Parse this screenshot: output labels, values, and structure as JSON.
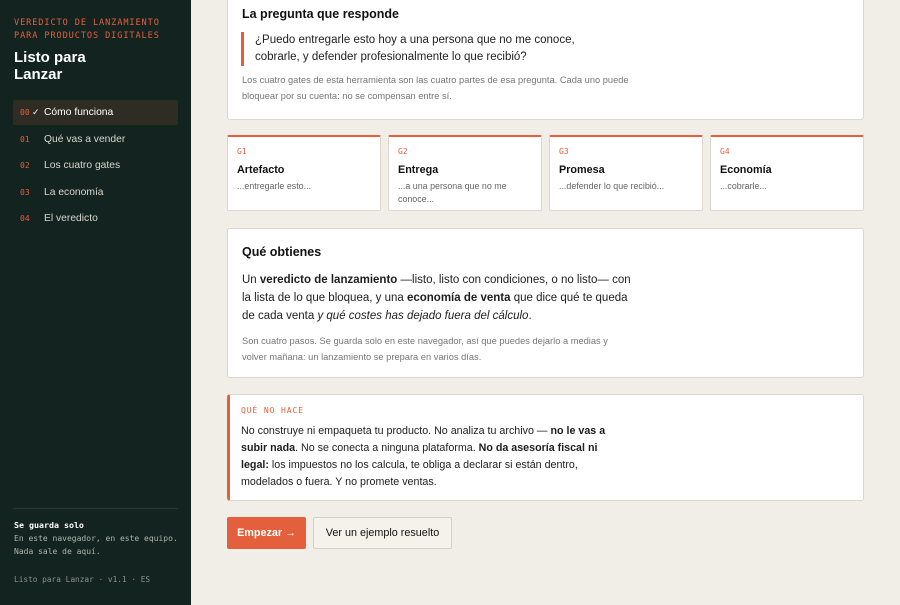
{
  "sidebar": {
    "kicker": "Veredicto de lanzamiento para productos digitales",
    "title": "Listo para Lanzar",
    "items": [
      {
        "num": "00",
        "check": "✓",
        "label": "Cómo funciona"
      },
      {
        "num": "01",
        "label": "Qué vas a vender"
      },
      {
        "num": "02",
        "label": "Los cuatro gates"
      },
      {
        "num": "03",
        "label": "La economía"
      },
      {
        "num": "04",
        "label": "El veredicto"
      }
    ],
    "save_title": "Se guarda solo",
    "save_body": "En este navegador, en este equipo. Nada sale de aquí.",
    "version": "Listo para Lanzar · v1.1 · ES"
  },
  "question": {
    "heading": "La pregunta que responde",
    "quote": "¿Puedo entregarle esto hoy a una persona que no me conoce, cobrarle, y defender profesionalmente lo que recibió?",
    "note": "Los cuatro gates de esta herramienta son las cuatro partes de esa pregunta. Cada uno puede bloquear por su cuenta: no se compensan entre sí."
  },
  "gates": [
    {
      "code": "G1",
      "title": "Artefacto",
      "desc": "...entregarle esto..."
    },
    {
      "code": "G2",
      "title": "Entrega",
      "desc": "...a una persona que no me conoce..."
    },
    {
      "code": "G3",
      "title": "Promesa",
      "desc": "...defender lo que recibió..."
    },
    {
      "code": "G4",
      "title": "Economía",
      "desc": "...cobrarle..."
    }
  ],
  "obtain": {
    "heading": "Qué obtienes",
    "p1": "Un ",
    "b1": "veredicto de lanzamiento",
    "p2": " —listo, listo con condiciones, o no listo— con la lista de lo que bloquea, y una ",
    "b2": "economía de venta",
    "p3": " que dice qué te queda de cada venta ",
    "i1": "y qué costes has dejado fuera del cálculo",
    "p4": ".",
    "note": "Son cuatro pasos. Se guarda solo en este navegador, así que puedes dejarlo a medias y volver mañana: un lanzamiento se prepara en varios días."
  },
  "not_does": {
    "kicker": "QUÉ NO HACE",
    "p1": "No construye ni empaqueta tu producto. No analiza tu archivo — ",
    "b1": "no le vas a subir nada",
    "p2": ". No se conecta a ninguna plataforma. ",
    "b2": "No da asesoría fiscal ni legal:",
    "p3": " los impuestos no los calcula, te obliga a declarar si están dentro, modelados o fuera. Y no promete ventas."
  },
  "buttons": {
    "start": "Empezar →",
    "example": "Ver un ejemplo resuelto"
  },
  "colors": {
    "accent": "#e4603c",
    "sidebar_bg": "#13231f",
    "page_bg": "#f1eee7"
  }
}
